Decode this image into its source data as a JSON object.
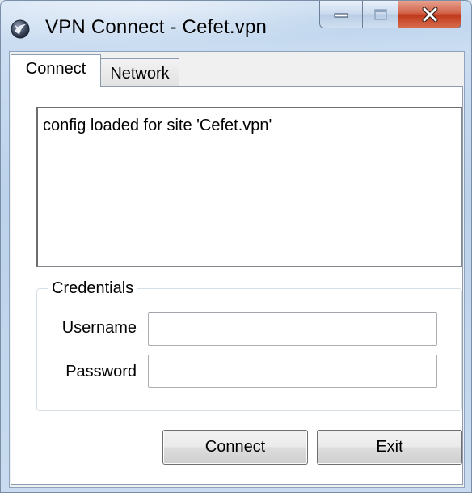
{
  "window": {
    "title": "VPN Connect - Cefet.vpn",
    "icon": "vpn-globe-icon"
  },
  "tabs": [
    {
      "label": "Connect",
      "active": true
    },
    {
      "label": "Network",
      "active": false
    }
  ],
  "log": {
    "text": "config loaded for site 'Cefet.vpn'"
  },
  "credentials": {
    "group_label": "Credentials",
    "username_label": "Username",
    "username_value": "",
    "password_label": "Password",
    "password_value": ""
  },
  "buttons": {
    "connect": "Connect",
    "exit": "Exit"
  },
  "colors": {
    "close_button": "#c84a2c",
    "titlebar": "#c8dbef"
  }
}
